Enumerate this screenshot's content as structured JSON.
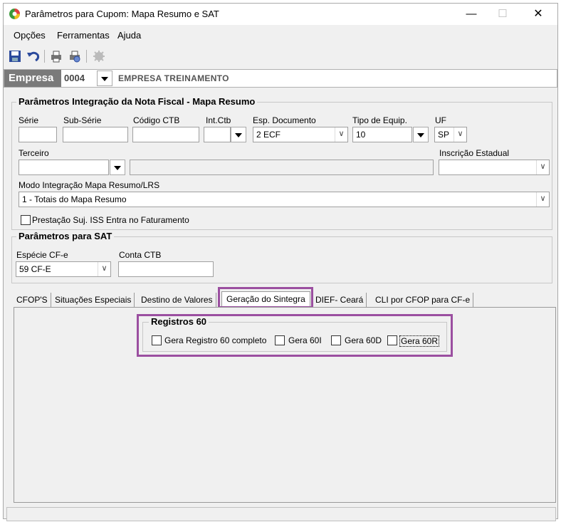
{
  "window": {
    "title": "Parâmetros para Cupom: Mapa Resumo e SAT",
    "controls": {
      "minimize": "—",
      "maximize": "☐",
      "close": "✕"
    }
  },
  "menu": {
    "items": [
      "Opções",
      "Ferramentas",
      "Ajuda"
    ]
  },
  "toolbar": {
    "icons": [
      "save-icon",
      "undo-icon",
      "print-icon",
      "print-preview-icon",
      "settings-icon"
    ]
  },
  "empresa": {
    "label": "Empresa",
    "code": "0004",
    "name": "EMPRESA TREINAMENTO"
  },
  "nf_group": {
    "title": "Parâmetros Integração da Nota Fiscal - Mapa Resumo",
    "serie_label": "Série",
    "serie_value": "",
    "subserie_label": "Sub-Série",
    "subserie_value": "",
    "codigo_ctb_label": "Código CTB",
    "codigo_ctb_value": "",
    "int_ctb_label": "Int.Ctb",
    "int_ctb_value": "",
    "esp_doc_label": "Esp. Documento",
    "esp_doc_value": "2 ECF",
    "tipo_equip_label": "Tipo de Equip.",
    "tipo_equip_value": "10",
    "uf_label": "UF",
    "uf_value": "SP",
    "terceiro_label": "Terceiro",
    "terceiro_value": "",
    "inscricao_label": "Inscrição Estadual",
    "inscricao_value": "",
    "modo_label": "Modo Integração Mapa Resumo/LRS",
    "modo_value": "1 - Totais do Mapa Resumo",
    "prestacao_label": "Prestação Suj. ISS Entra no Faturamento",
    "prestacao_checked": false
  },
  "sat_group": {
    "title": "Parâmetros para SAT",
    "especie_label": "Espécie CF-e",
    "especie_value": "59 CF-E",
    "conta_ctb_label": "Conta CTB",
    "conta_ctb_value": ""
  },
  "tabs": [
    "CFOP'S",
    "Situações Especiais",
    "Destino de Valores",
    "Geração do Sintegra",
    "DIEF- Ceará",
    "CLI por CFOP para CF-e"
  ],
  "active_tab": "Geração do Sintegra",
  "registros60": {
    "title": "Registros 60",
    "options": [
      {
        "label": "Gera Registro 60 completo",
        "checked": false
      },
      {
        "label": "Gera 60I",
        "checked": false
      },
      {
        "label": "Gera 60D",
        "checked": false
      },
      {
        "label": "Gera 60R",
        "checked": false
      }
    ]
  },
  "colors": {
    "highlight": "#9b4fa0",
    "empresa_bg": "#7a7a7a",
    "window_bg": "#f0f0f0"
  }
}
